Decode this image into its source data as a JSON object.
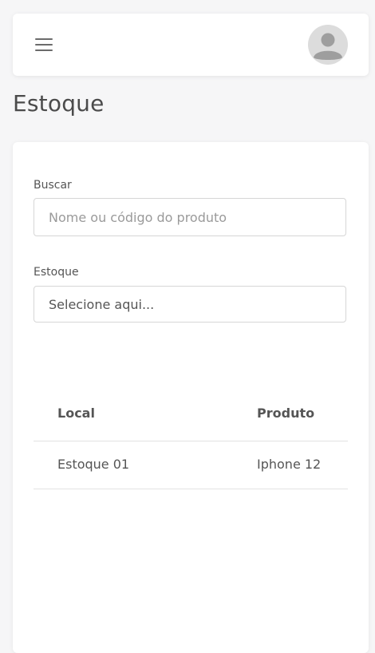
{
  "header": {
    "menu_icon": "hamburger-menu-icon",
    "avatar_icon": "user-avatar-icon"
  },
  "page": {
    "title": "Estoque"
  },
  "filters": {
    "search": {
      "label": "Buscar",
      "placeholder": "Nome ou código do produto",
      "value": ""
    },
    "stock": {
      "label": "Estoque",
      "selected": "Selecione aqui..."
    }
  },
  "table": {
    "columns": [
      "Local",
      "Produto"
    ],
    "rows": [
      [
        "Estoque 01",
        "Iphone 12"
      ]
    ]
  },
  "colors": {
    "background": "#f6f6f7",
    "surface": "#ffffff",
    "text": "#555555",
    "border": "#d6d6d6",
    "avatar_bg": "#dcdcdc",
    "avatar_fg": "#9e9e9e"
  }
}
